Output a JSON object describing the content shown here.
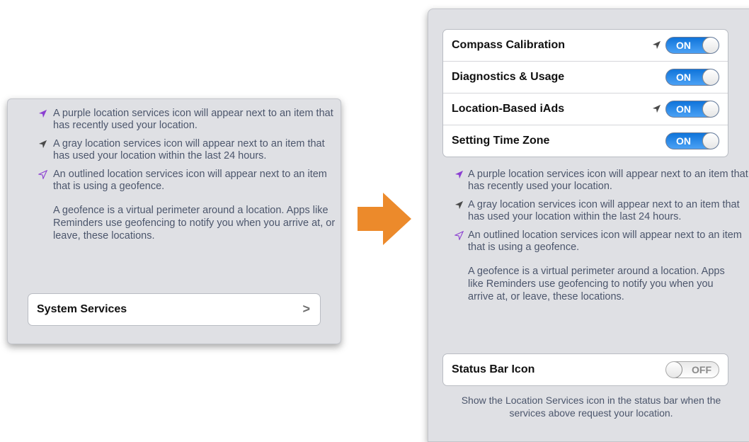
{
  "legend": [
    {
      "icon": "purple-location-icon",
      "color": "#8b3fd1",
      "text": "A purple location services icon will appear next to an item that has recently used your location."
    },
    {
      "icon": "gray-location-icon",
      "color": "#4a4a4a",
      "text": "A gray location services icon will appear next to an item that has used your location within the last 24 hours."
    },
    {
      "icon": "outlined-location-icon",
      "color": "#8b3fd1",
      "text": "An outlined location services icon will appear next to an item that is using a geofence."
    }
  ],
  "geofence_note": "A geofence is a virtual perimeter around a location. Apps like Reminders use geofencing to notify you when you arrive at, or leave, these locations.",
  "left": {
    "system_services_label": "System Services",
    "chevron": ">"
  },
  "right": {
    "settings": [
      {
        "label": "Compass Calibration",
        "state": "ON",
        "location_icon": "gray-location-icon"
      },
      {
        "label": "Diagnostics & Usage",
        "state": "ON",
        "location_icon": ""
      },
      {
        "label": "Location-Based iAds",
        "state": "ON",
        "location_icon": "gray-location-icon"
      },
      {
        "label": "Setting Time Zone",
        "state": "ON",
        "location_icon": ""
      }
    ],
    "status_bar": {
      "label": "Status Bar Icon",
      "state": "OFF"
    },
    "status_bar_note": "Show the Location Services icon in the status bar when the services above request your location."
  },
  "colors": {
    "arrow": "#ec8a2b",
    "toggle_on": "#1a7fe6"
  }
}
